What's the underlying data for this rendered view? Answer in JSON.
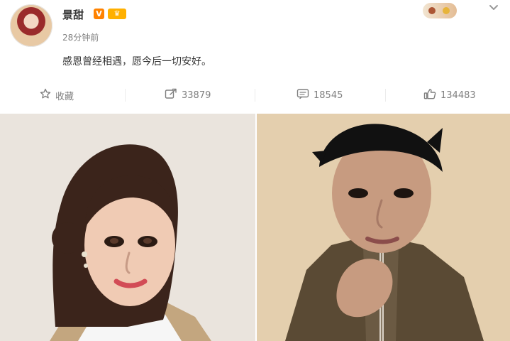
{
  "post": {
    "author": "景甜",
    "verified_badge": "V",
    "level_badge": "♛",
    "time": "28分钟前",
    "content": "感恩曾经相遇，愿今后一切安好。"
  },
  "actions": {
    "favorite_label": "收藏",
    "repost_count": "33879",
    "comment_count": "18545",
    "like_count": "134483"
  },
  "icons": [
    "avatar",
    "star-icon",
    "share-icon",
    "comment-icon",
    "like-icon",
    "chevron-down-icon"
  ],
  "colors": {
    "icon": "#7f7f7f",
    "orange_badge": "#ff8200"
  }
}
